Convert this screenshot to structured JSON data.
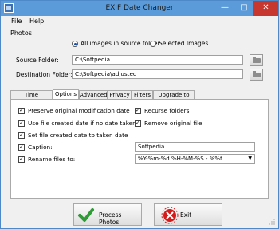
{
  "window": {
    "title": "EXIF Date Changer",
    "minimize_glyph": "—",
    "maximize_glyph": "□",
    "close_glyph": "✕"
  },
  "menu": {
    "file": "File",
    "help": "Help"
  },
  "photos": {
    "group_label": "Photos",
    "radio_all": "All images in source folder",
    "radio_selected": "Selected Images",
    "source_label": "Source Folder:",
    "source_value": "C:\\Softpedia",
    "dest_label": "Destination Folder:",
    "dest_value": "C:\\Softpedia\\adjusted"
  },
  "tabs": [
    "Time Difference",
    "Options",
    "Advanced",
    "Privacy",
    "Filters",
    "Upgrade to Pro"
  ],
  "active_tab": "Options",
  "options": {
    "preserve_mod_date": "Preserve original modification date",
    "use_created_date": "Use file created date if no date taken",
    "set_created_date": "Set file created date to taken date",
    "caption_label": "Caption:",
    "caption_value": "Softpedia",
    "rename_label": "Rename files to:",
    "rename_value": "%Y-%m-%d %H-%M-%S - %%f",
    "recurse_folders": "Recurse folders",
    "remove_original": "Remove original file"
  },
  "buttons": {
    "process": "Process Photos",
    "exit": "Exit"
  },
  "icons": {
    "app": "camera-icon",
    "browse": "folder-icon",
    "process": "checkmark-icon",
    "exit": "stop-icon"
  },
  "colors": {
    "titlebar": "#5b9bd9",
    "close": "#c7372f",
    "check_green": "#2e9b36",
    "exit_red": "#d31b1b"
  }
}
